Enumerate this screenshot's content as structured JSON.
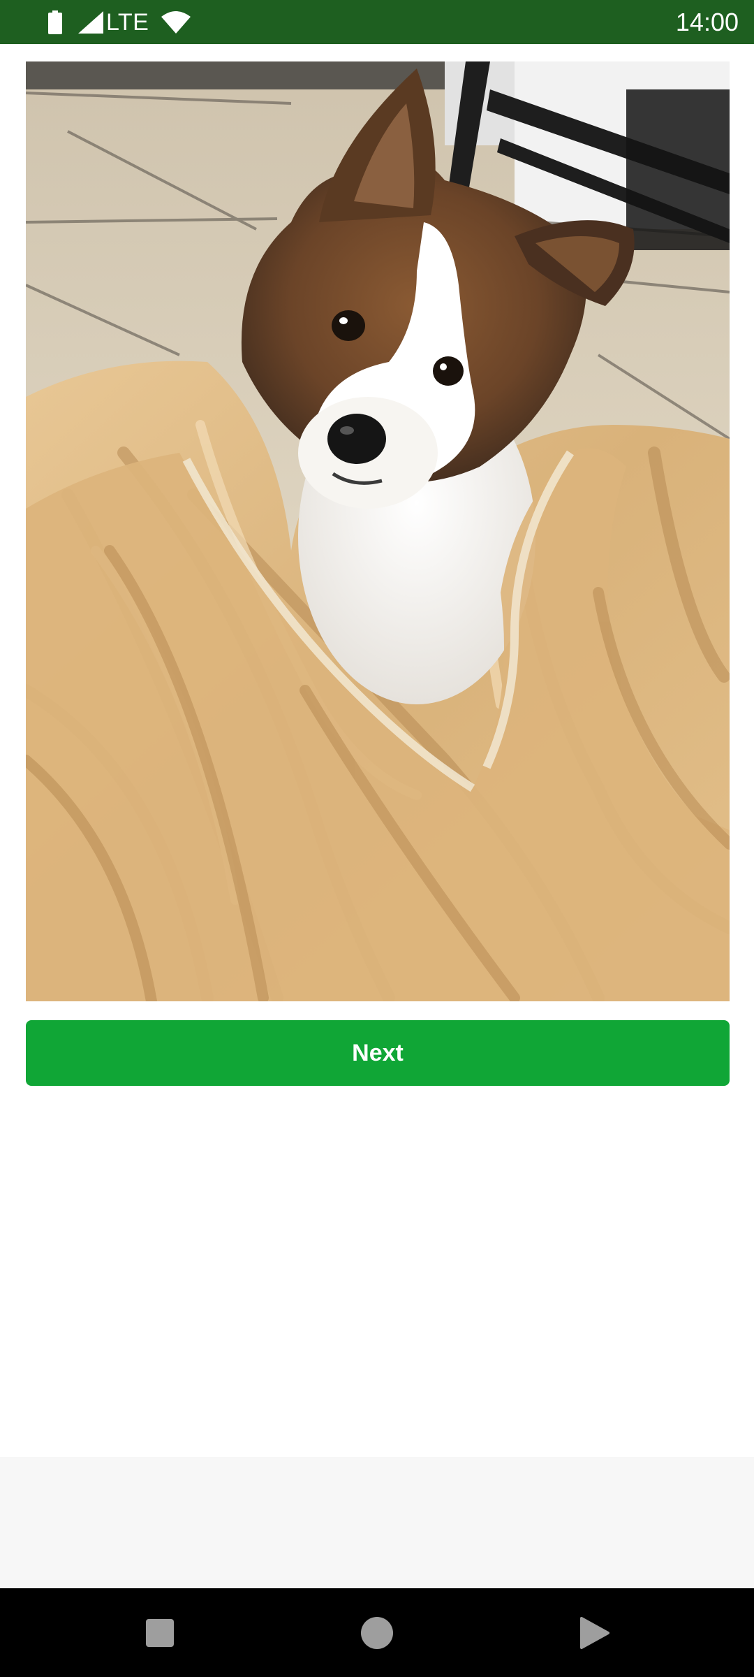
{
  "status_bar": {
    "network_label": "LTE",
    "clock": "14:00",
    "icons": [
      "battery-icon",
      "signal-icon",
      "wifi-icon"
    ],
    "background_color": "#1e5f20"
  },
  "content": {
    "image_icon": "puppy-photo",
    "next_button_label": "Next",
    "accent_color": "#10a636"
  },
  "nav_bar": {
    "icons": [
      "recents-square-icon",
      "home-circle-icon",
      "back-triangle-icon"
    ]
  }
}
